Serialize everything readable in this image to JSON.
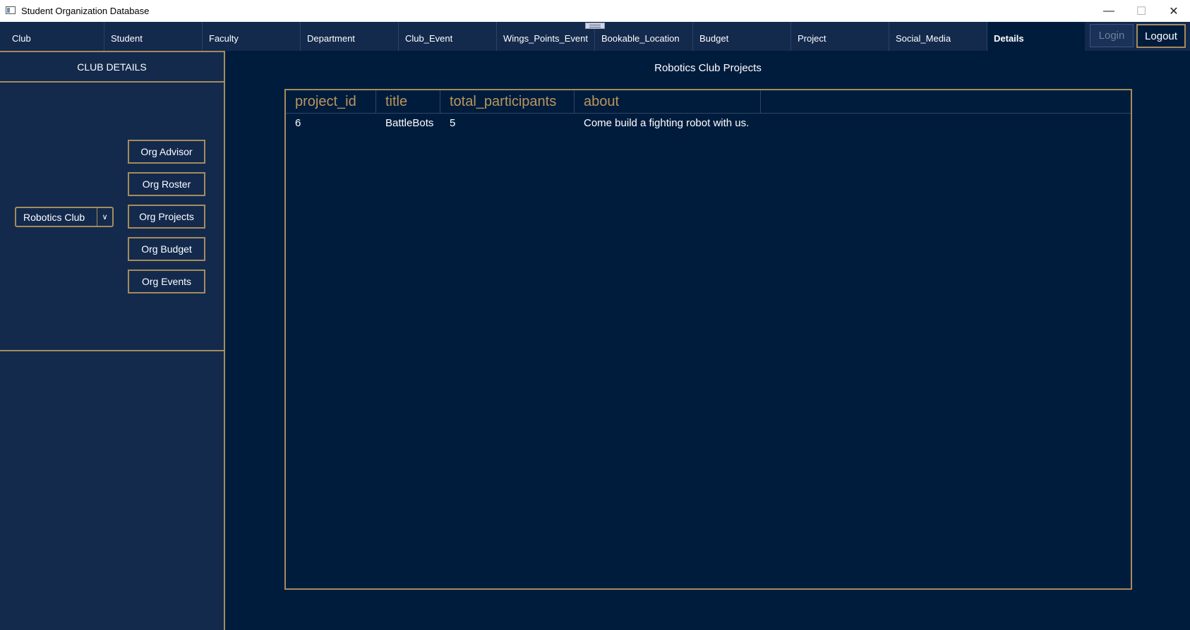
{
  "window": {
    "title": "Student Organization Database",
    "minimize_icon": "minimize-icon",
    "maximize_icon": "maximize-icon",
    "close_icon": "close-icon"
  },
  "tabs": [
    {
      "label": "Club"
    },
    {
      "label": "Student"
    },
    {
      "label": "Faculty"
    },
    {
      "label": "Department"
    },
    {
      "label": "Club_Event"
    },
    {
      "label": "Wings_Points_Event"
    },
    {
      "label": "Bookable_Location"
    },
    {
      "label": "Budget"
    },
    {
      "label": "Project"
    },
    {
      "label": "Social_Media"
    },
    {
      "label": "Details",
      "active": true
    }
  ],
  "auth": {
    "login_label": "Login",
    "logout_label": "Logout"
  },
  "sidebar": {
    "header": "CLUB DETAILS",
    "club_select": {
      "value": "Robotics Club"
    },
    "buttons": [
      {
        "label": "Org Advisor"
      },
      {
        "label": "Org Roster"
      },
      {
        "label": "Org Projects"
      },
      {
        "label": "Org Budget"
      },
      {
        "label": "Org Events"
      }
    ]
  },
  "main": {
    "title": "Robotics Club Projects",
    "table": {
      "columns": [
        "project_id",
        "title",
        "total_participants",
        "about"
      ],
      "rows": [
        [
          "6",
          "BattleBots",
          "5",
          "Come build a fighting robot with us."
        ]
      ]
    }
  },
  "colors": {
    "background": "#001c3d",
    "panel": "#132a4d",
    "accent_gold": "#a68b5b",
    "header_text": "#b9965d"
  }
}
